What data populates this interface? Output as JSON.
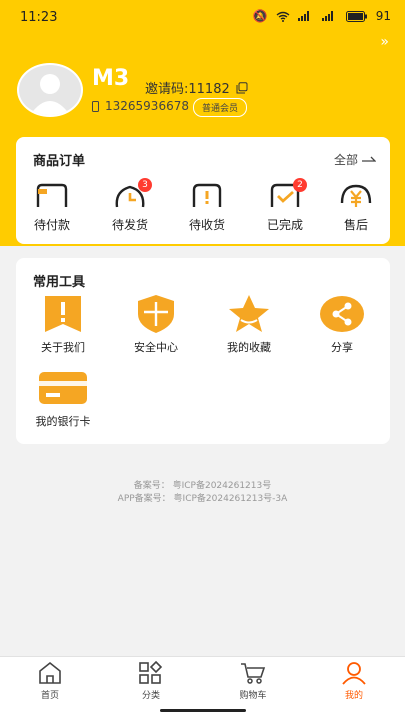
{
  "status_bar": {
    "time": "11:23",
    "battery": "91"
  },
  "profile": {
    "name": "M3",
    "invite_label": "邀请码:11182",
    "phone": "13265936678",
    "member_level": "普通会员"
  },
  "orders": {
    "title": "商品订单",
    "more_label": "全部",
    "items": [
      {
        "label": "待付款",
        "icon": "wallet-icon",
        "badge": ""
      },
      {
        "label": "待发货",
        "icon": "clock-icon",
        "badge": "3"
      },
      {
        "label": "待收货",
        "icon": "package-alert-icon",
        "badge": ""
      },
      {
        "label": "已完成",
        "icon": "check-box-icon",
        "badge": "2"
      },
      {
        "label": "售后",
        "icon": "yen-refund-icon",
        "badge": ""
      }
    ]
  },
  "tools": {
    "title": "常用工具",
    "items": [
      {
        "label": "关于我们",
        "icon": "info-flag-icon"
      },
      {
        "label": "安全中心",
        "icon": "shield-icon"
      },
      {
        "label": "我的收藏",
        "icon": "star-icon"
      },
      {
        "label": "分享",
        "icon": "share-icon"
      },
      {
        "label": "我的银行卡",
        "icon": "bank-card-icon"
      }
    ]
  },
  "record": {
    "icp": "备案号： 粤ICP备2024261213号",
    "app_icp": "APP备案号： 粤ICP备2024261213号-3A"
  },
  "tabbar": {
    "items": [
      {
        "label": "首页",
        "icon": "home-icon",
        "active": false
      },
      {
        "label": "分类",
        "icon": "category-icon",
        "active": false
      },
      {
        "label": "购物车",
        "icon": "cart-icon",
        "active": false
      },
      {
        "label": "我的",
        "icon": "user-icon",
        "active": true
      }
    ]
  },
  "colors": {
    "brand_yellow": "#ffcc00",
    "icon_orange": "#f5a623",
    "active_tab": "#ff5a00",
    "badge_red": "#ff3b30"
  }
}
